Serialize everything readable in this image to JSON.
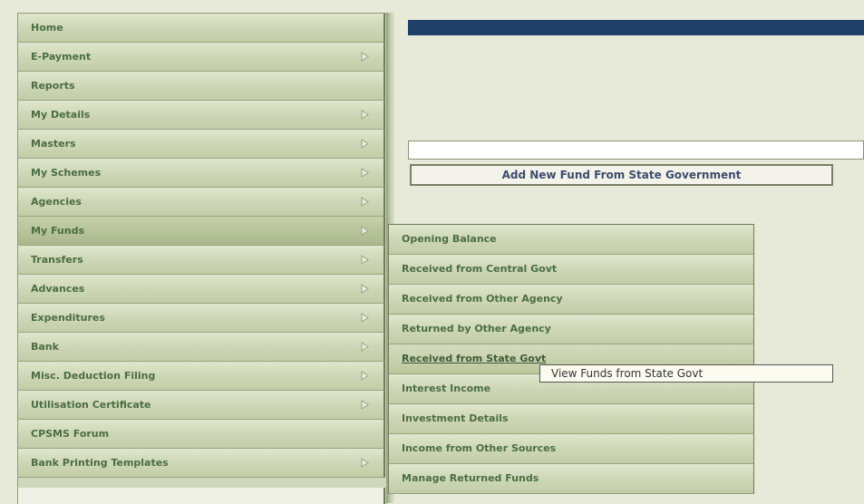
{
  "menu": {
    "items": [
      {
        "label": "Home",
        "arrow": false
      },
      {
        "label": "E-Payment",
        "arrow": true
      },
      {
        "label": "Reports",
        "arrow": false
      },
      {
        "label": "My Details",
        "arrow": true
      },
      {
        "label": "Masters",
        "arrow": true
      },
      {
        "label": "My Schemes",
        "arrow": true
      },
      {
        "label": "Agencies",
        "arrow": true
      },
      {
        "label": "My Funds",
        "arrow": true,
        "active": true
      },
      {
        "label": "Transfers",
        "arrow": true
      },
      {
        "label": "Advances",
        "arrow": true
      },
      {
        "label": "Expenditures",
        "arrow": true
      },
      {
        "label": "Bank",
        "arrow": true
      },
      {
        "label": "Misc. Deduction Filing",
        "arrow": true
      },
      {
        "label": "Utilisation Certificate",
        "arrow": true
      },
      {
        "label": "CPSMS Forum",
        "arrow": false
      },
      {
        "label": "Bank Printing Templates",
        "arrow": true
      }
    ]
  },
  "submenu": {
    "items": [
      {
        "label": "Opening Balance"
      },
      {
        "label": "Received from Central Govt"
      },
      {
        "label": "Received from Other Agency"
      },
      {
        "label": "Returned by Other Agency"
      },
      {
        "label": "Received from State Govt",
        "hover": true
      },
      {
        "label": "Interest Income"
      },
      {
        "label": "Investment Details"
      },
      {
        "label": "Income from Other Sources"
      },
      {
        "label": "Manage Returned Funds"
      }
    ]
  },
  "content": {
    "add_button_label": "Add New Fund From State Government",
    "input_value": ""
  },
  "tooltip": {
    "text": "View Funds from State Govt"
  },
  "colors": {
    "menu_text": "#4c6d43",
    "top_bar": "#1e3f66"
  },
  "icons": {
    "submenu_arrow": "arrow-right-icon"
  }
}
